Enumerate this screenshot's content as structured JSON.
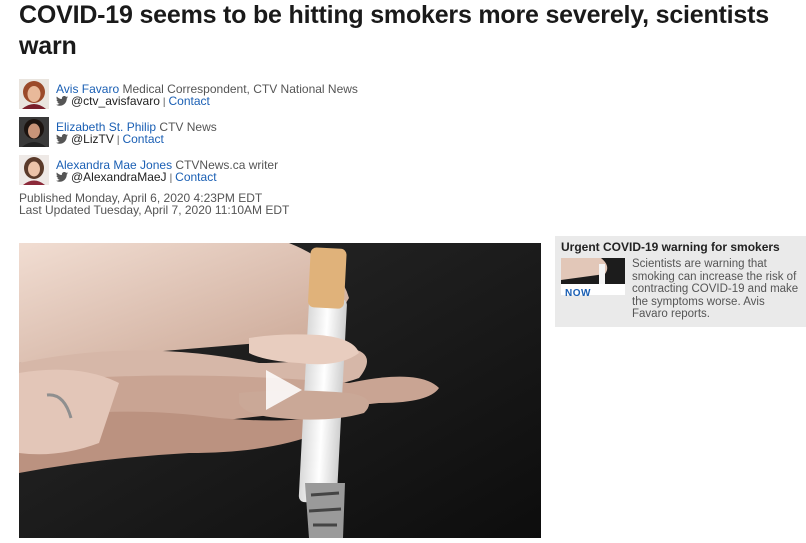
{
  "article": {
    "headline": "COVID-19 seems to be hitting smokers more severely, scientists warn"
  },
  "authors": [
    {
      "name": "Avis Favaro",
      "role": "Medical Correspondent, CTV National News",
      "twitter": "@ctv_avisfavaro",
      "contact": "Contact",
      "separator": "|"
    },
    {
      "name": "Elizabeth St. Philip",
      "role": "CTV News",
      "twitter": "@LizTV",
      "contact": "Contact",
      "separator": "|"
    },
    {
      "name": "Alexandra Mae Jones",
      "role": "CTVNews.ca writer",
      "twitter": "@AlexandraMaeJ",
      "contact": "Contact",
      "separator": "|"
    }
  ],
  "dates": {
    "published": "Published Monday, April 6, 2020 4:23PM EDT",
    "updated": "Last Updated Tuesday, April 7, 2020 11:10AM EDT"
  },
  "video": {
    "play_icon": "play-icon"
  },
  "sidebar": {
    "title": "Urgent COVID-19 warning for smokers",
    "badge": "NOW",
    "description": "Scientists are warning that smoking can increase the risk of contracting COVID-19 and make the symptoms worse. Avis Favaro reports."
  },
  "colors": {
    "link": "#1a5fb4",
    "sidebar_bg": "#eaeaea",
    "headline": "#1a1a1a"
  }
}
